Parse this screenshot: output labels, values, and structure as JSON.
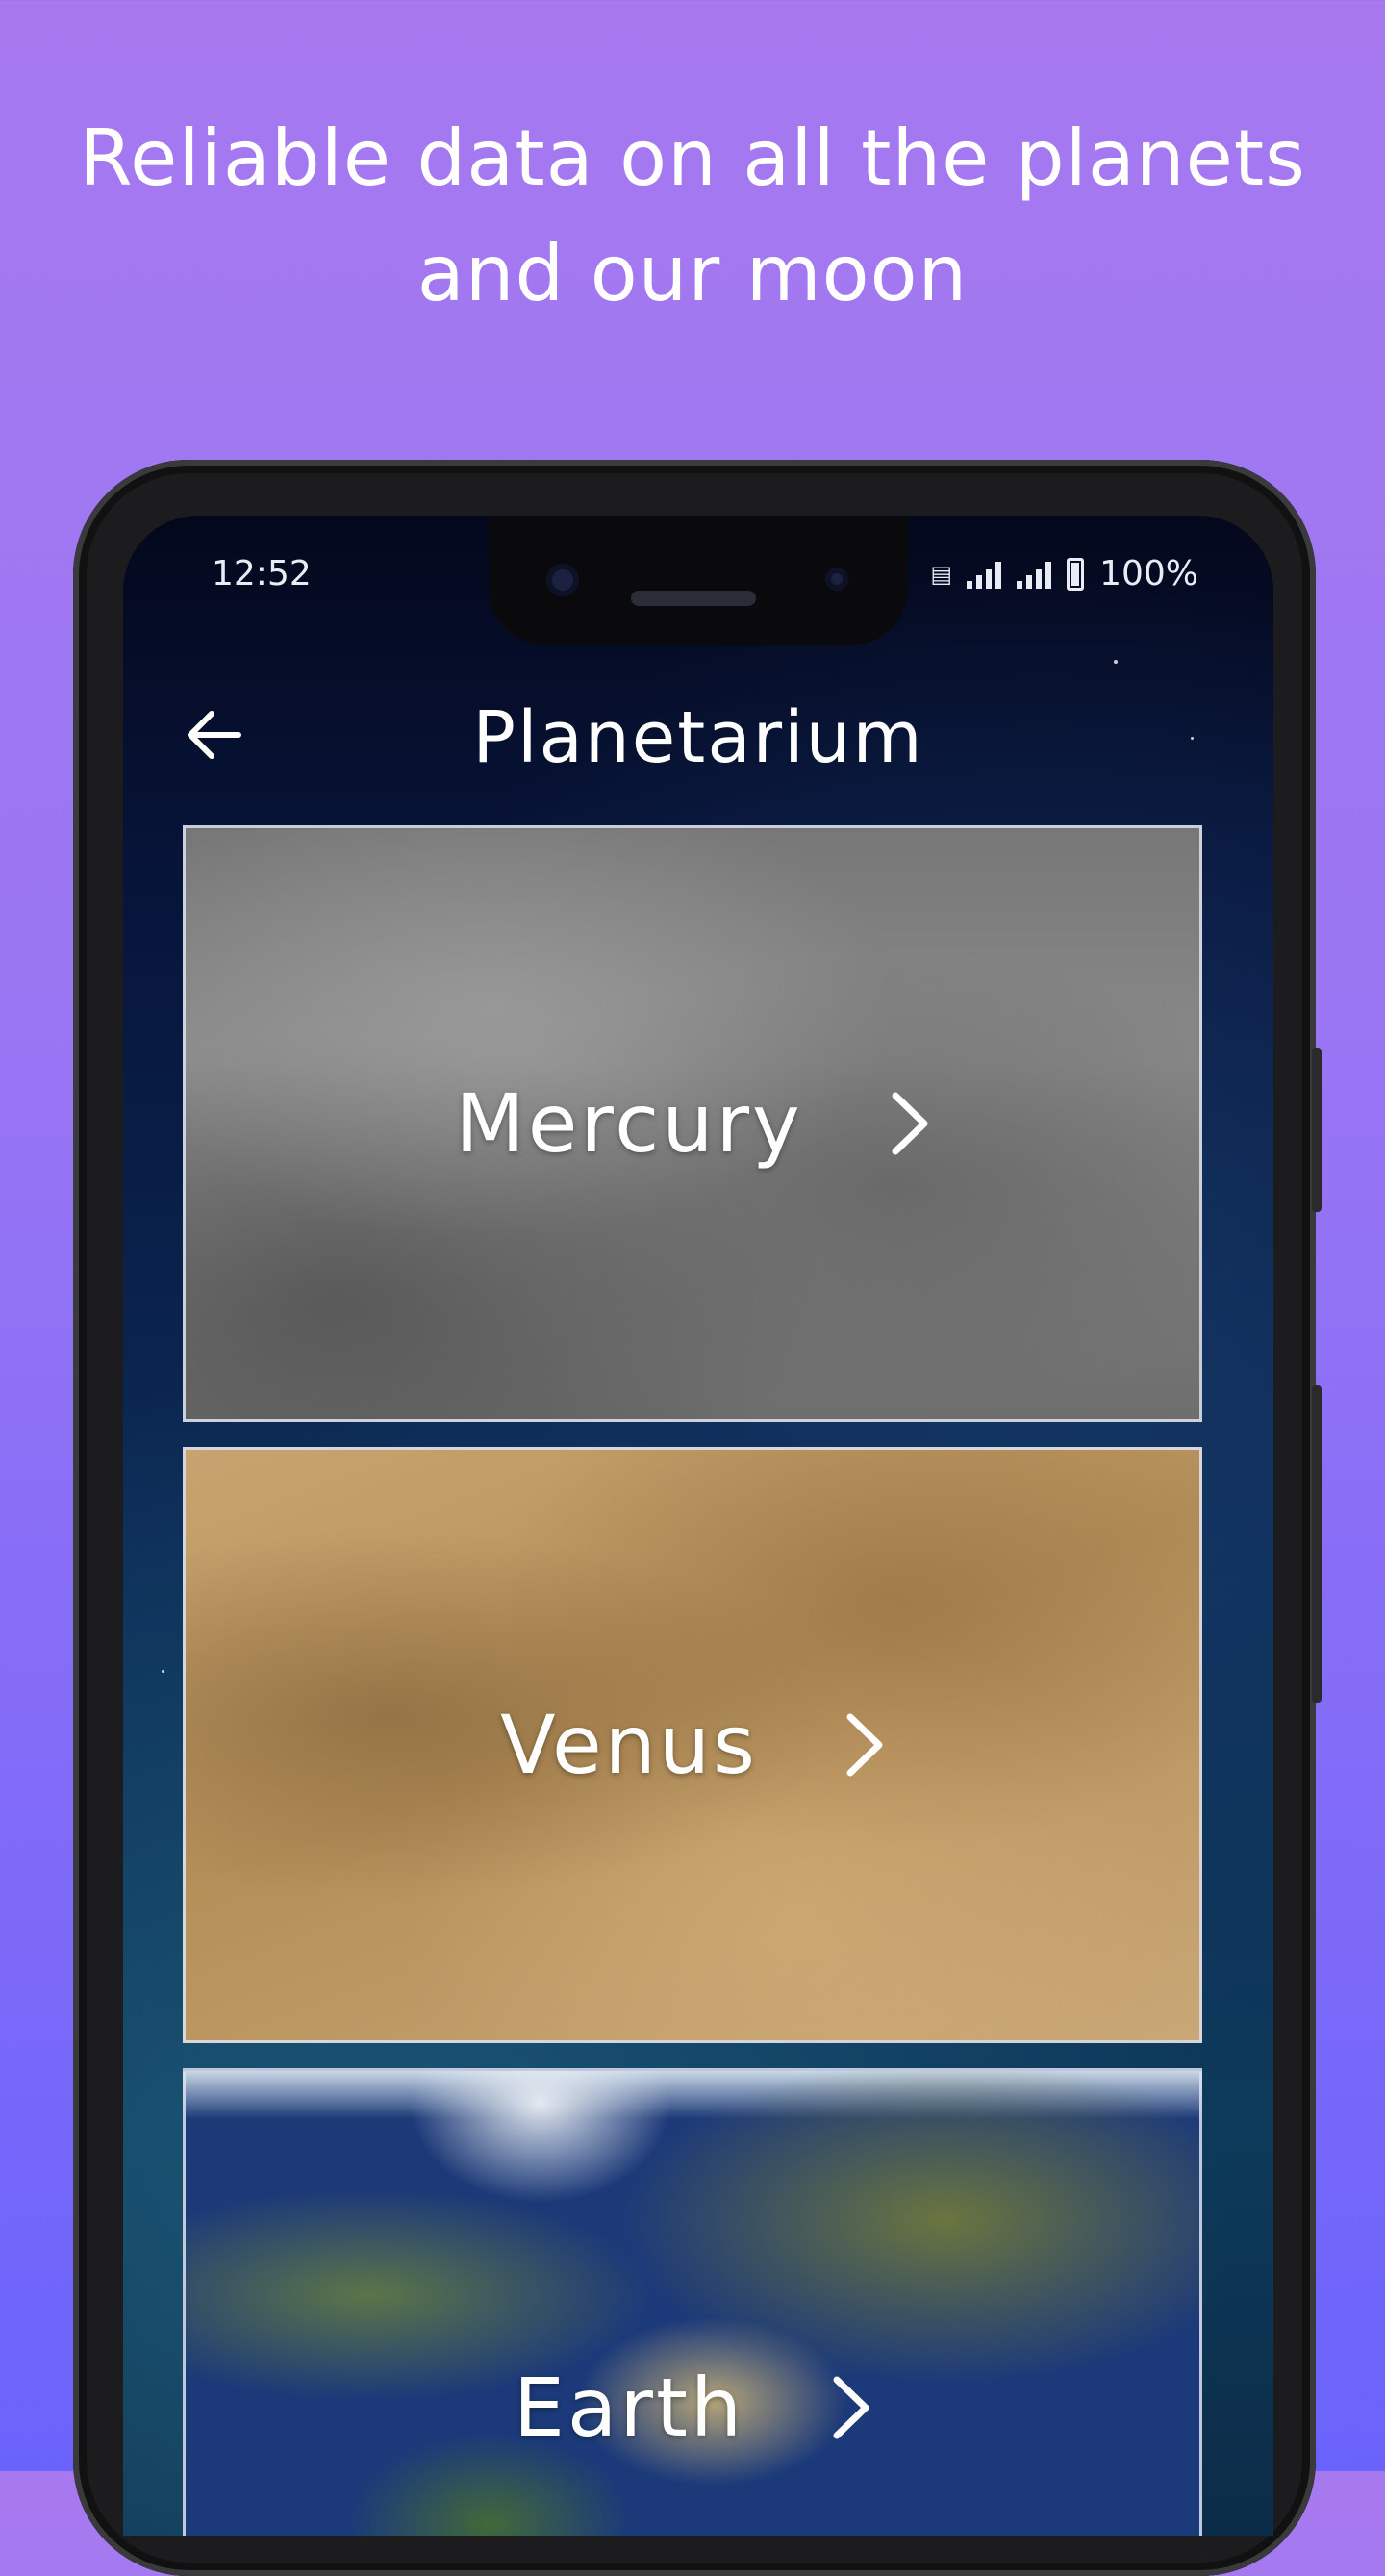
{
  "promo": {
    "line1": "Reliable data on all the planets",
    "line2": "and our moon"
  },
  "status_bar": {
    "time": "12:52",
    "battery": "100%",
    "icons": [
      "nfc-icon",
      "signal-icon",
      "signal-icon",
      "battery-icon"
    ]
  },
  "app_bar": {
    "title": "Planetarium",
    "back_icon": "arrow-left-icon"
  },
  "planets": [
    {
      "name": "Mercury",
      "icon": "chevron-right-icon"
    },
    {
      "name": "Venus",
      "icon": "chevron-right-icon"
    },
    {
      "name": "Earth",
      "icon": "chevron-right-icon"
    }
  ],
  "colors": {
    "background_top": "#a679ef",
    "background_bottom": "#6a63fb",
    "text": "#ffffff"
  }
}
